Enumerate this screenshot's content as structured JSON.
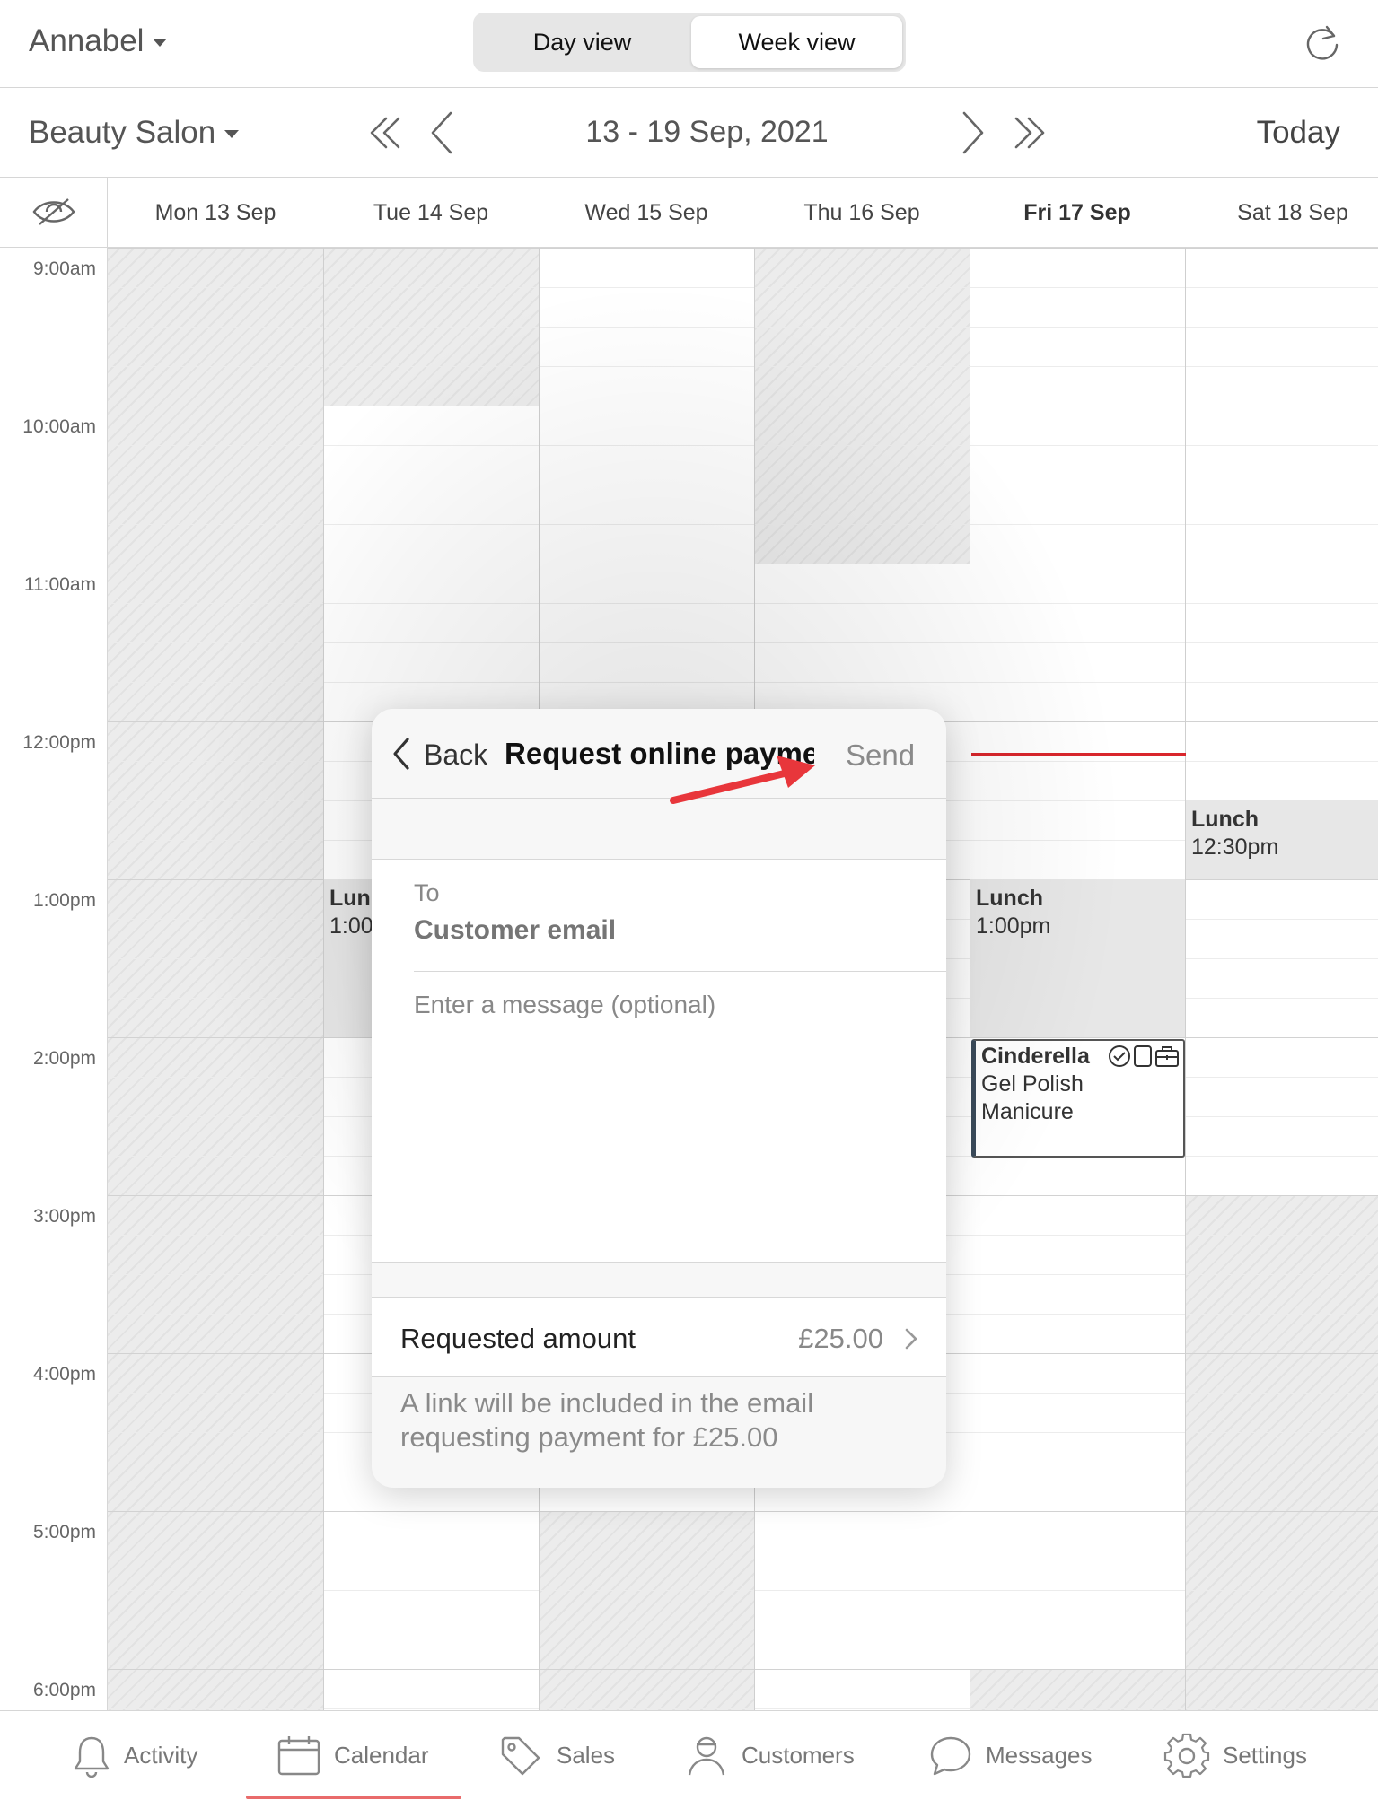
{
  "header": {
    "staff_name": "Annabel",
    "view_toggle": {
      "day": "Day view",
      "week": "Week view",
      "selected": "Week view"
    },
    "refresh_icon": "refresh-icon"
  },
  "nav": {
    "location": "Beauty Salon",
    "date_range": "13 - 19 Sep, 2021",
    "today_label": "Today"
  },
  "days": [
    "Mon 13 Sep",
    "Tue 14 Sep",
    "Wed 15 Sep",
    "Thu 16 Sep",
    "Fri 17 Sep",
    "Sat 18 Sep"
  ],
  "current_day": "Fri 17 Sep",
  "times": [
    "9:00am",
    "10:00am",
    "11:00am",
    "12:00pm",
    "1:00pm",
    "2:00pm",
    "3:00pm",
    "4:00pm",
    "5:00pm",
    "6:00pm"
  ],
  "events": {
    "lunch_tue": {
      "title": "Lun",
      "time": "1:00"
    },
    "lunch_fri": {
      "title": "Lunch",
      "time": "1:00pm"
    },
    "lunch_sat": {
      "title": "Lunch",
      "time": "12:30pm"
    },
    "appointment": {
      "client": "Cinderella",
      "service_line1": "Gel Polish",
      "service_line2": "Manicure"
    }
  },
  "popover": {
    "back_label": "Back",
    "title": "Request online payment",
    "send_label": "Send",
    "to_label": "To",
    "email_placeholder": "Customer email",
    "message_placeholder": "Enter a message (optional)",
    "amount_label": "Requested amount",
    "amount_value": "£25.00",
    "note": "A link will be included in the email requesting payment for £25.00"
  },
  "tabs": [
    {
      "label": "Activity",
      "icon": "bell-icon"
    },
    {
      "label": "Calendar",
      "icon": "calendar-icon"
    },
    {
      "label": "Sales",
      "icon": "tag-icon"
    },
    {
      "label": "Customers",
      "icon": "person-icon"
    },
    {
      "label": "Messages",
      "icon": "chat-icon"
    },
    {
      "label": "Settings",
      "icon": "gear-icon"
    }
  ],
  "selected_tab": "Calendar",
  "colors": {
    "now_line": "#d9262c",
    "tab_underline": "#e96b6b",
    "annotation_arrow": "#e8363b"
  }
}
